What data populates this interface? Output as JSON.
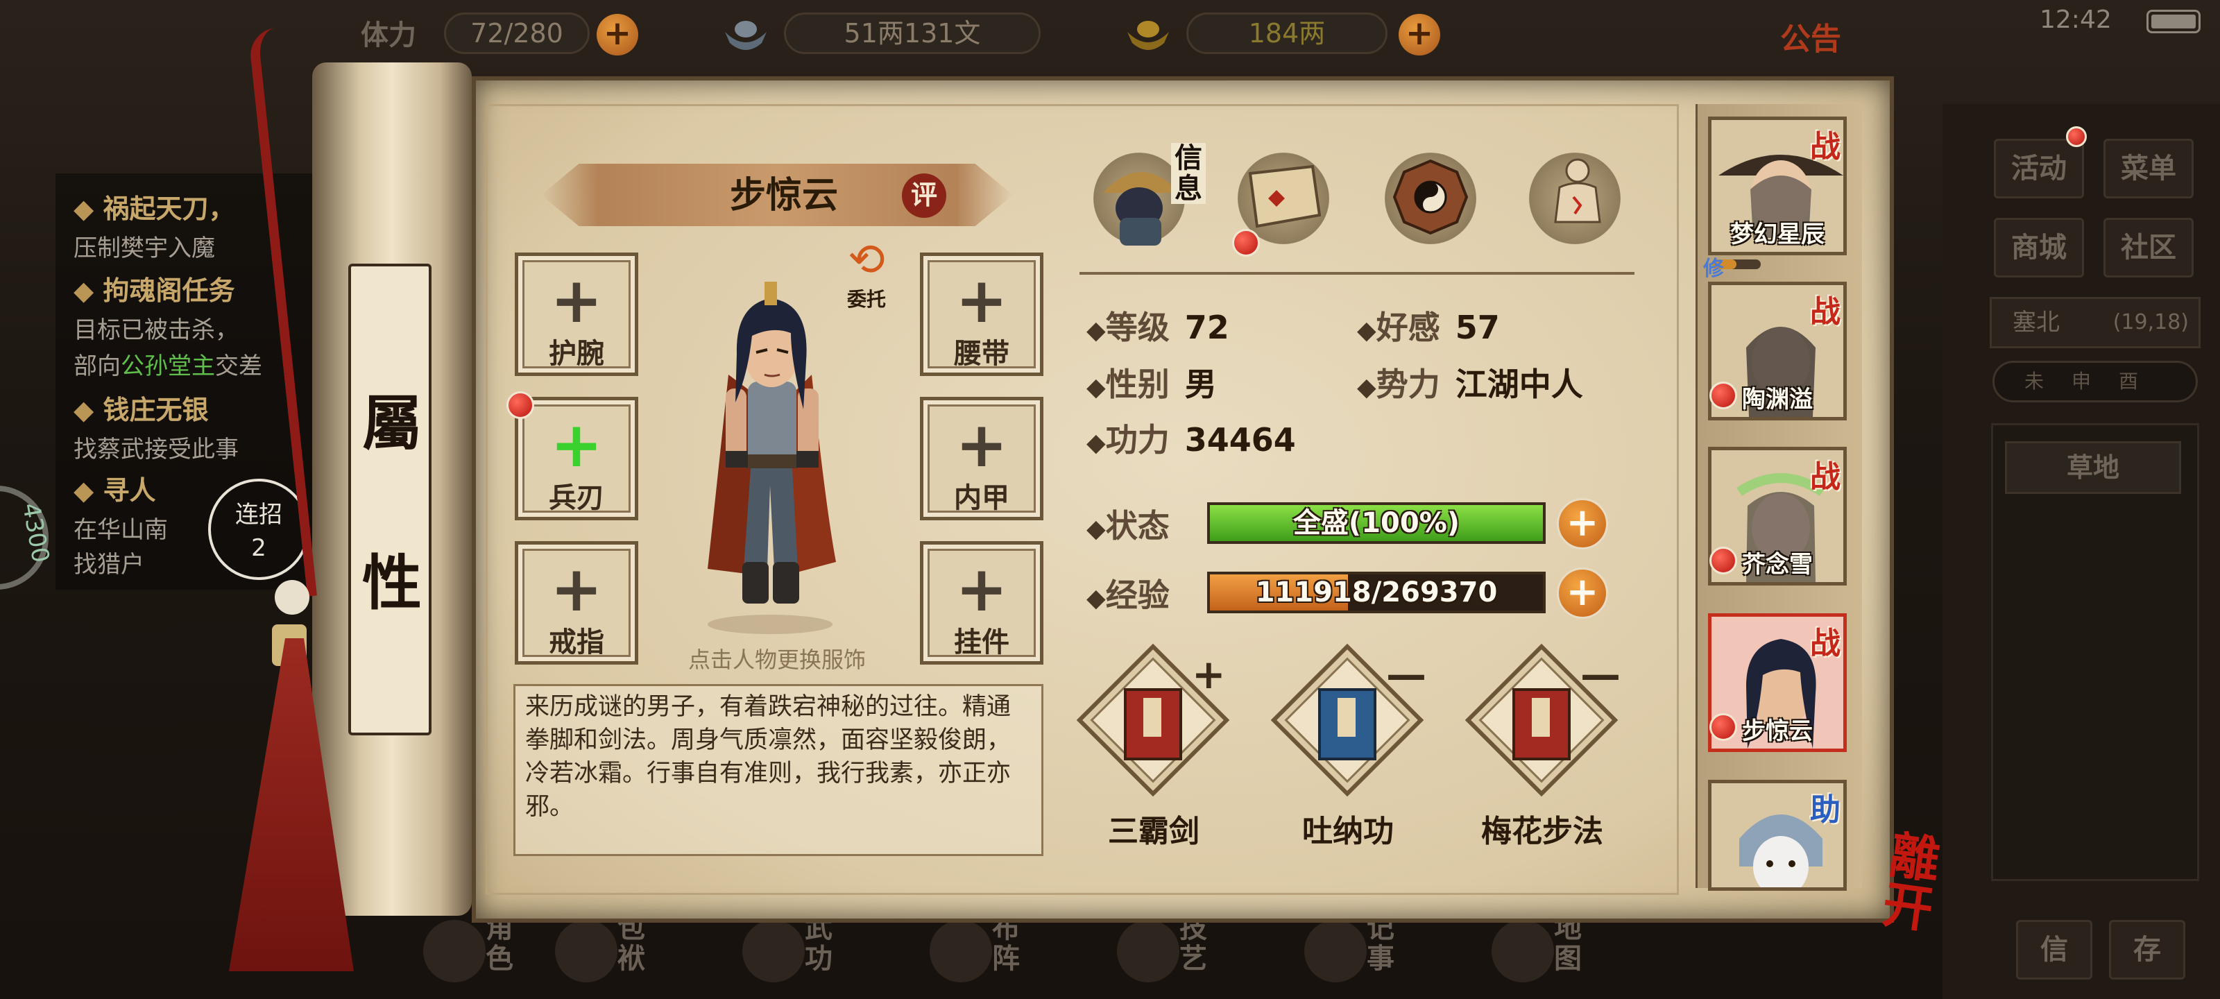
{
  "top_bar": {
    "stamina_label": "体力",
    "stamina_value": "72/280",
    "silver_value": "51两131文",
    "gold_value": "184两",
    "notice": "公告",
    "time": "12:42"
  },
  "quests": [
    {
      "title": "祸起天刀，",
      "lines": [
        "压制樊宇入魔"
      ]
    },
    {
      "title": "拘魂阁任务",
      "lines": [
        "目标已被击杀，",
        "部向公孙堂主交差"
      ]
    },
    {
      "title": "钱庄无银",
      "lines": [
        "找蔡武接受此事"
      ]
    },
    {
      "title": "寻人",
      "lines": [
        "在华山南",
        "找猎户"
      ]
    }
  ],
  "quest_highlight": "公孙堂主",
  "combo": {
    "label": "连招",
    "count": "2"
  },
  "left_badge": "4300",
  "scroll_title": [
    "屬",
    "性"
  ],
  "character": {
    "name": "步惊云",
    "eval_label": "评",
    "delegate_label": "委托",
    "hint": "点击人物更换服饰",
    "description": "来历成谜的男子，有着跌宕神秘的过往。精通拳脚和剑法。周身气质凛然，面容坚毅俊朗，冷若冰霜。行事自有准则，我行我素，亦正亦邪。"
  },
  "equipment": {
    "left": [
      "护腕",
      "兵刃",
      "戒指"
    ],
    "right": [
      "腰带",
      "内甲",
      "挂件"
    ]
  },
  "tabs": {
    "info_label": "信息"
  },
  "stats": {
    "level_label": "等级",
    "level_value": "72",
    "favor_label": "好感",
    "favor_value": "57",
    "gender_label": "性别",
    "gender_value": "男",
    "faction_label": "势力",
    "faction_value": "江湖中人",
    "power_label": "功力",
    "power_value": "34464",
    "state_label": "状态",
    "state_value": "全盛(100%)",
    "state_fraction": 1.0,
    "exp_label": "经验",
    "exp_value": "111918/269370",
    "exp_fraction": 0.4155
  },
  "skills": [
    {
      "name": "三霸剑",
      "mark": "+"
    },
    {
      "name": "吐纳功",
      "mark": "—"
    },
    {
      "name": "梅花步法",
      "mark": "—"
    }
  ],
  "team": [
    {
      "name": "梦幻星辰",
      "role": "战"
    },
    {
      "name": "陶渊溢",
      "role": "战"
    },
    {
      "name": "芥念雪",
      "role": "战"
    },
    {
      "name": "步惊云",
      "role": "战"
    },
    {
      "name": "",
      "role": "助"
    }
  ],
  "team_mini_icon": "修",
  "leave_label": "離开",
  "right_panel": {
    "buttons": [
      "活动",
      "菜单",
      "商城",
      "社区"
    ],
    "location": "塞北",
    "coords": "(19,18)",
    "compass": "未申酉",
    "terrain": "草地",
    "bottom_buttons": [
      "信",
      "存"
    ]
  },
  "bottom_nav": [
    "角色",
    "包袱",
    "武功",
    "布阵",
    "技艺",
    "记事",
    "地图"
  ],
  "colors": {
    "accent_red": "#c5281a",
    "state_green": "#5fc22c",
    "exp_orange": "#e0852e",
    "paper": "#e3d4b4"
  },
  "icons": {
    "stamina": "stamina-icon",
    "silver": "ingot-silver-icon",
    "gold": "ingot-gold-icon",
    "delegate": "swap-arrows-icon",
    "tab_info": "straw-hat-warrior-icon",
    "tab_bag": "map-scroll-icon",
    "tab_formation": "bagua-icon",
    "tab_skill": "meridian-body-icon"
  }
}
